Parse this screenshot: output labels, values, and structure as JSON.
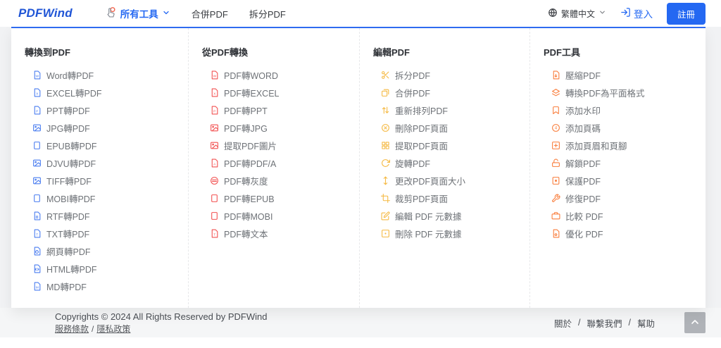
{
  "nav": {
    "logo": "PDFWind",
    "all_tools_label": "所有工具",
    "links": [
      "合併PDF",
      "拆分PDF"
    ],
    "language": "繁體中文",
    "login_label": "登入",
    "register_label": "註冊"
  },
  "menu": {
    "columns": [
      {
        "header": "轉換到PDF",
        "color": "#4a7df0",
        "items": [
          {
            "label": "Word轉PDF",
            "icon": "file-word"
          },
          {
            "label": "EXCEL轉PDF",
            "icon": "file-excel"
          },
          {
            "label": "PPT轉PDF",
            "icon": "file-ppt"
          },
          {
            "label": "JPG轉PDF",
            "icon": "file-image"
          },
          {
            "label": "EPUB轉PDF",
            "icon": "book"
          },
          {
            "label": "DJVU轉PDF",
            "icon": "file-image"
          },
          {
            "label": "TIFF轉PDF",
            "icon": "file-image"
          },
          {
            "label": "MOBI轉PDF",
            "icon": "book"
          },
          {
            "label": "RTF轉PDF",
            "icon": "file-plain"
          },
          {
            "label": "TXT轉PDF",
            "icon": "file-text"
          },
          {
            "label": "網頁轉PDF",
            "icon": "file-web"
          },
          {
            "label": "HTML轉PDF",
            "icon": "file-code"
          },
          {
            "label": "MD轉PDF",
            "icon": "file-md"
          }
        ]
      },
      {
        "header": "從PDF轉換",
        "color": "#f25050",
        "items": [
          {
            "label": "PDF轉WORD",
            "icon": "file-word"
          },
          {
            "label": "PDF轉EXCEL",
            "icon": "file-excel"
          },
          {
            "label": "PDF轉PPT",
            "icon": "file-ppt"
          },
          {
            "label": "PDF轉JPG",
            "icon": "file-image"
          },
          {
            "label": "提取PDF圖片",
            "icon": "file-image"
          },
          {
            "label": "PDF轉PDF/A",
            "icon": "file-a"
          },
          {
            "label": "PDF轉灰度",
            "icon": "grayscale"
          },
          {
            "label": "PDF轉EPUB",
            "icon": "book"
          },
          {
            "label": "PDF轉MOBI",
            "icon": "book"
          },
          {
            "label": "PDF轉文本",
            "icon": "file-text"
          }
        ]
      },
      {
        "header": "編輯PDF",
        "color": "#f5b942",
        "items": [
          {
            "label": "拆分PDF",
            "icon": "scissors"
          },
          {
            "label": "合併PDF",
            "icon": "merge"
          },
          {
            "label": "重新排列PDF",
            "icon": "reorder"
          },
          {
            "label": "刪除PDF頁面",
            "icon": "delete-circle"
          },
          {
            "label": "提取PDF頁面",
            "icon": "extract-grid"
          },
          {
            "label": "旋轉PDF",
            "icon": "rotate"
          },
          {
            "label": "更改PDF頁面大小",
            "icon": "resize"
          },
          {
            "label": "裁剪PDF頁面",
            "icon": "crop"
          },
          {
            "label": "編輯 PDF 元數據",
            "icon": "edit-square"
          },
          {
            "label": "刪除 PDF 元數據",
            "icon": "dot-square"
          }
        ]
      },
      {
        "header": "PDF工具",
        "color": "#f97e3d",
        "items": [
          {
            "label": "壓縮PDF",
            "icon": "compress"
          },
          {
            "label": "轉換PDF為平面格式",
            "icon": "flatten-layers"
          },
          {
            "label": "添加水印",
            "icon": "bookmark"
          },
          {
            "label": "添加頁碼",
            "icon": "page-number"
          },
          {
            "label": "添加頁眉和頁腳",
            "icon": "plus-square"
          },
          {
            "label": "解鎖PDF",
            "icon": "unlock"
          },
          {
            "label": "保護PDF",
            "icon": "protect"
          },
          {
            "label": "修復PDF",
            "icon": "wrench"
          },
          {
            "label": "比較 PDF",
            "icon": "compare"
          },
          {
            "label": "優化 PDF",
            "icon": "optimize"
          }
        ]
      }
    ]
  },
  "footer": {
    "copyright": "Copyrights © 2024 All Rights Reserved by PDFWind",
    "legal_links": [
      "服務條款",
      "隱私政策"
    ],
    "links": [
      "關於",
      "聯繫我們",
      "幫助"
    ],
    "sep": "/"
  }
}
